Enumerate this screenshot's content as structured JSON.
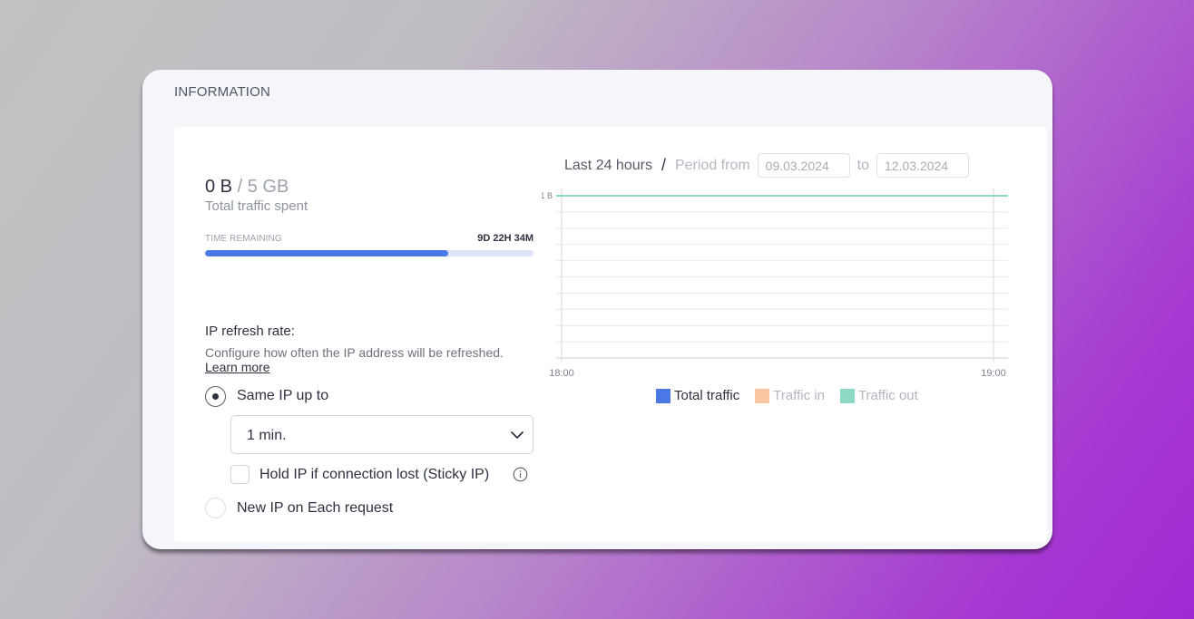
{
  "card": {
    "title": "INFORMATION"
  },
  "traffic": {
    "used": "0 B",
    "separator": " / ",
    "limit": "5 GB",
    "label": "Total traffic spent"
  },
  "time": {
    "label": "TIME REMAINING",
    "value": "9D 22H 34M",
    "progress_fraction": 0.74
  },
  "refresh": {
    "title": "IP refresh rate:",
    "description": "Configure how often the IP address will be refreshed.",
    "learn_more": "Learn more",
    "option_same": "Same IP up to",
    "interval_value": "1 min.",
    "sticky_label": "Hold IP if connection lost (Sticky IP)",
    "option_new": "New IP on Each request"
  },
  "period": {
    "active_tab": "Last 24 hours",
    "slash": "/",
    "from_label": "Period from",
    "from_date": "09.03.2024",
    "to_label": "to",
    "to_date": "12.03.2024"
  },
  "chart_data": {
    "type": "line",
    "x_ticks": [
      "18:00",
      "19:00"
    ],
    "y_ticks": [
      "1 B"
    ],
    "ylim": [
      0,
      1
    ],
    "grid": true,
    "series": [
      {
        "name": "Total traffic",
        "color": "#4a79e6",
        "values": []
      },
      {
        "name": "Traffic in",
        "color": "#f8c4a2",
        "values": []
      },
      {
        "name": "Traffic out",
        "color": "#8ed8c6",
        "values": [
          1,
          1
        ]
      }
    ],
    "legend": [
      "Total traffic",
      "Traffic in",
      "Traffic out"
    ]
  }
}
